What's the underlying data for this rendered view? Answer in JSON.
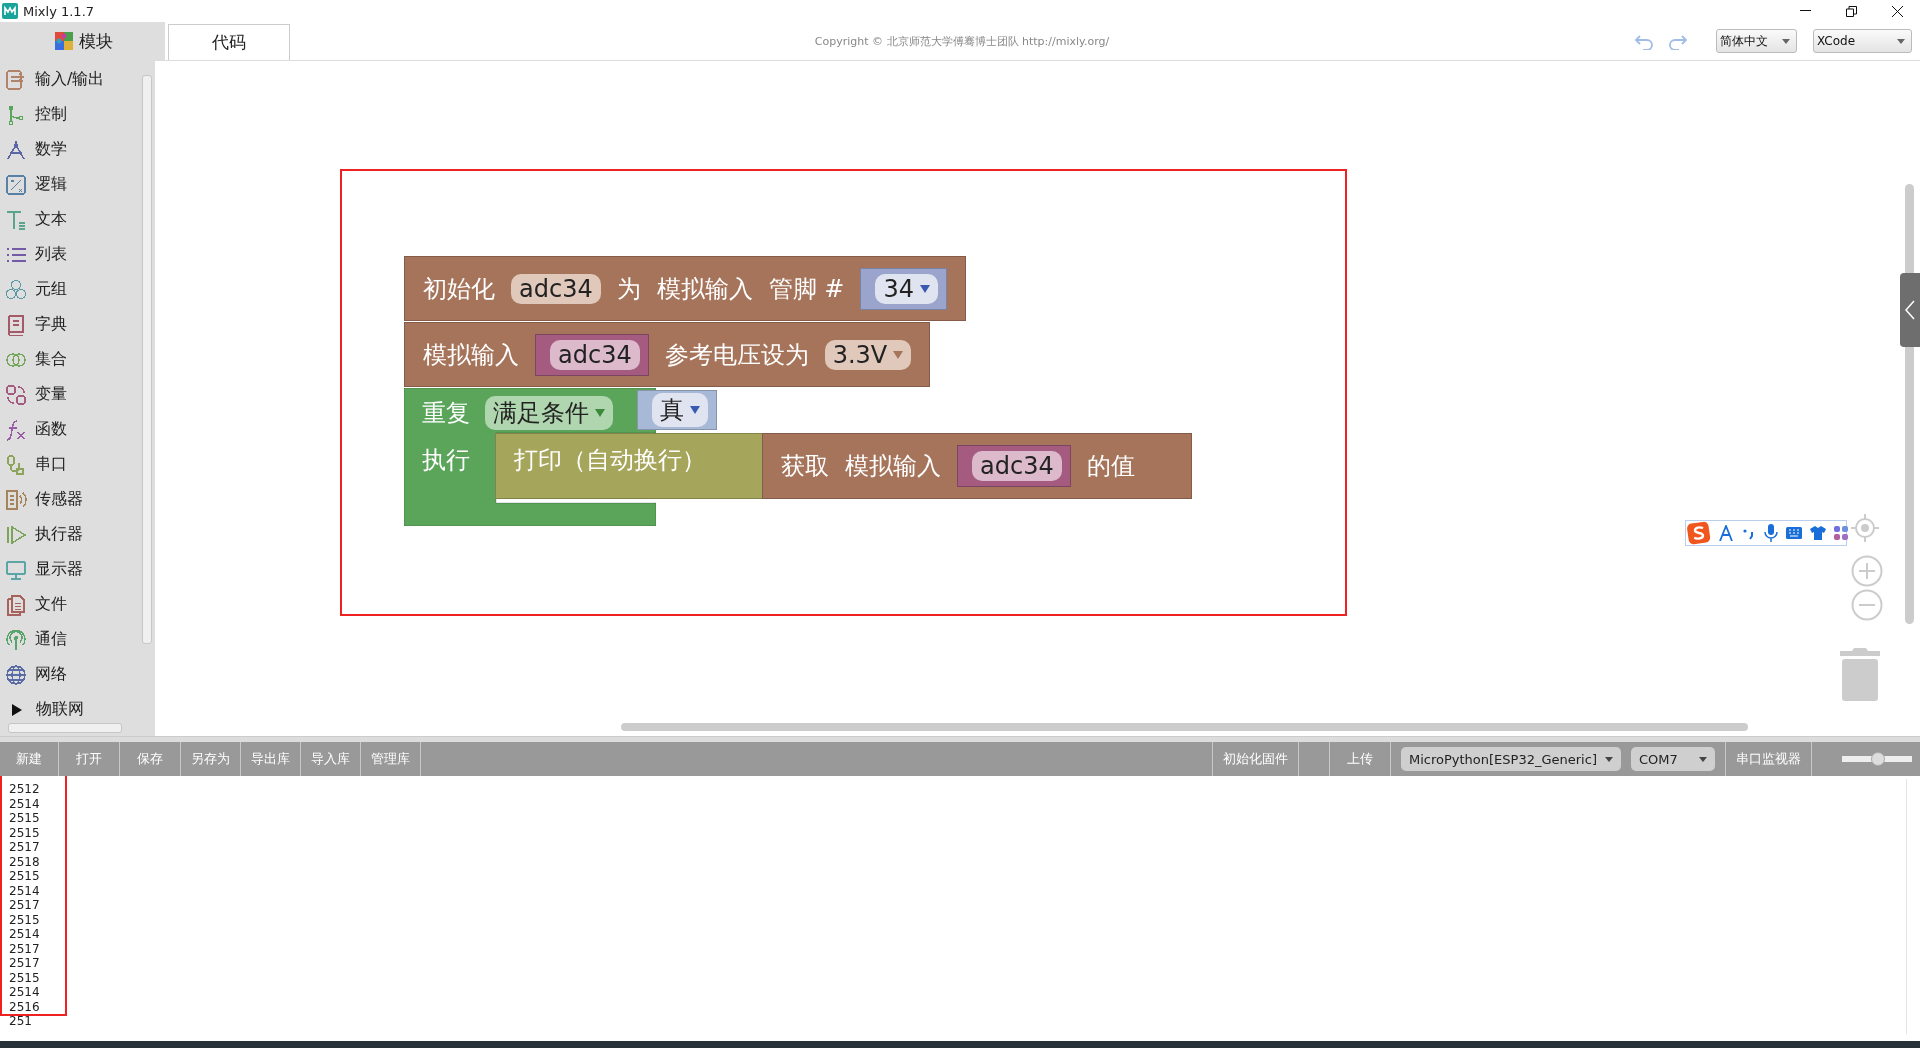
{
  "window": {
    "title": "Mixly 1.1.7"
  },
  "tabs": [
    {
      "label": "模块",
      "selected": true
    },
    {
      "label": "代码",
      "selected": false
    }
  ],
  "copyright": "Copyright © 北京师范大学傅骞博士团队 http://mixly.org/",
  "language_select": {
    "value": "简体中文"
  },
  "theme_select": {
    "value": "XCode"
  },
  "categories": [
    {
      "label": "输入/输出",
      "kind": "category",
      "color": "#b0836a"
    },
    {
      "label": "控制",
      "kind": "category",
      "color": "#5ba55b"
    },
    {
      "label": "数学",
      "kind": "category",
      "color": "#5b67a5"
    },
    {
      "label": "逻辑",
      "kind": "category",
      "color": "#5b80a5"
    },
    {
      "label": "文本",
      "kind": "category",
      "color": "#5ba58c"
    },
    {
      "label": "列表",
      "kind": "category",
      "color": "#745ba5"
    },
    {
      "label": "元组",
      "kind": "category",
      "color": "#5b9aa5"
    },
    {
      "label": "字典",
      "kind": "category",
      "color": "#a55b67"
    },
    {
      "label": "集合",
      "kind": "category",
      "color": "#74a55b"
    },
    {
      "label": "变量",
      "kind": "category",
      "color": "#a55b80"
    },
    {
      "label": "函数",
      "kind": "category",
      "color": "#995ba5"
    },
    {
      "label": "串口",
      "kind": "category",
      "color": "#8da55b"
    },
    {
      "label": "传感器",
      "kind": "category",
      "color": "#a5845b"
    },
    {
      "label": "执行器",
      "kind": "category",
      "color": "#7ca55b"
    },
    {
      "label": "显示器",
      "kind": "category",
      "color": "#5ba5a5"
    },
    {
      "label": "文件",
      "kind": "category",
      "color": "#a5635b"
    },
    {
      "label": "通信",
      "kind": "category",
      "color": "#5ba56b"
    },
    {
      "label": "网络",
      "kind": "category",
      "color": "#5b6ba5"
    },
    {
      "label": "物联网",
      "kind": "folder",
      "expanded": false
    }
  ],
  "init_block": {
    "label": "初始化",
    "variable": "adc34",
    "connector": "为",
    "mode": "模拟输入",
    "pin_label": "管脚 #",
    "pin": "34"
  },
  "voltage_block": {
    "label": "模拟输入",
    "variable": "adc34",
    "text": "参考电压设为",
    "voltage": "3.3V"
  },
  "repeat_block": {
    "label": "重复",
    "mode": "满足条件",
    "condition": "真",
    "do_label": "执行"
  },
  "print_block": {
    "label": "打印（自动换行）"
  },
  "read_block": {
    "label": "获取",
    "mode": "模拟输入",
    "variable": "adc34",
    "suffix": "的值"
  },
  "file_buttons": [
    "新建",
    "打开",
    "保存",
    "另存为",
    "导出库",
    "导入库",
    "管理库"
  ],
  "firmware_button": "初始化固件",
  "upload_button": "上传",
  "board_select": {
    "value": "MicroPython[ESP32_Generic]"
  },
  "port_select": {
    "value": "COM7"
  },
  "monitor_button": "串口监视器",
  "zoom_slider": {
    "level": 0.52
  },
  "output_lines": [
    "2512",
    "2514",
    "2515",
    "2515",
    "2517",
    "2518",
    "2515",
    "2514",
    "2517",
    "2515",
    "2514",
    "2517",
    "2517",
    "2515",
    "2514",
    "2516",
    "251"
  ]
}
